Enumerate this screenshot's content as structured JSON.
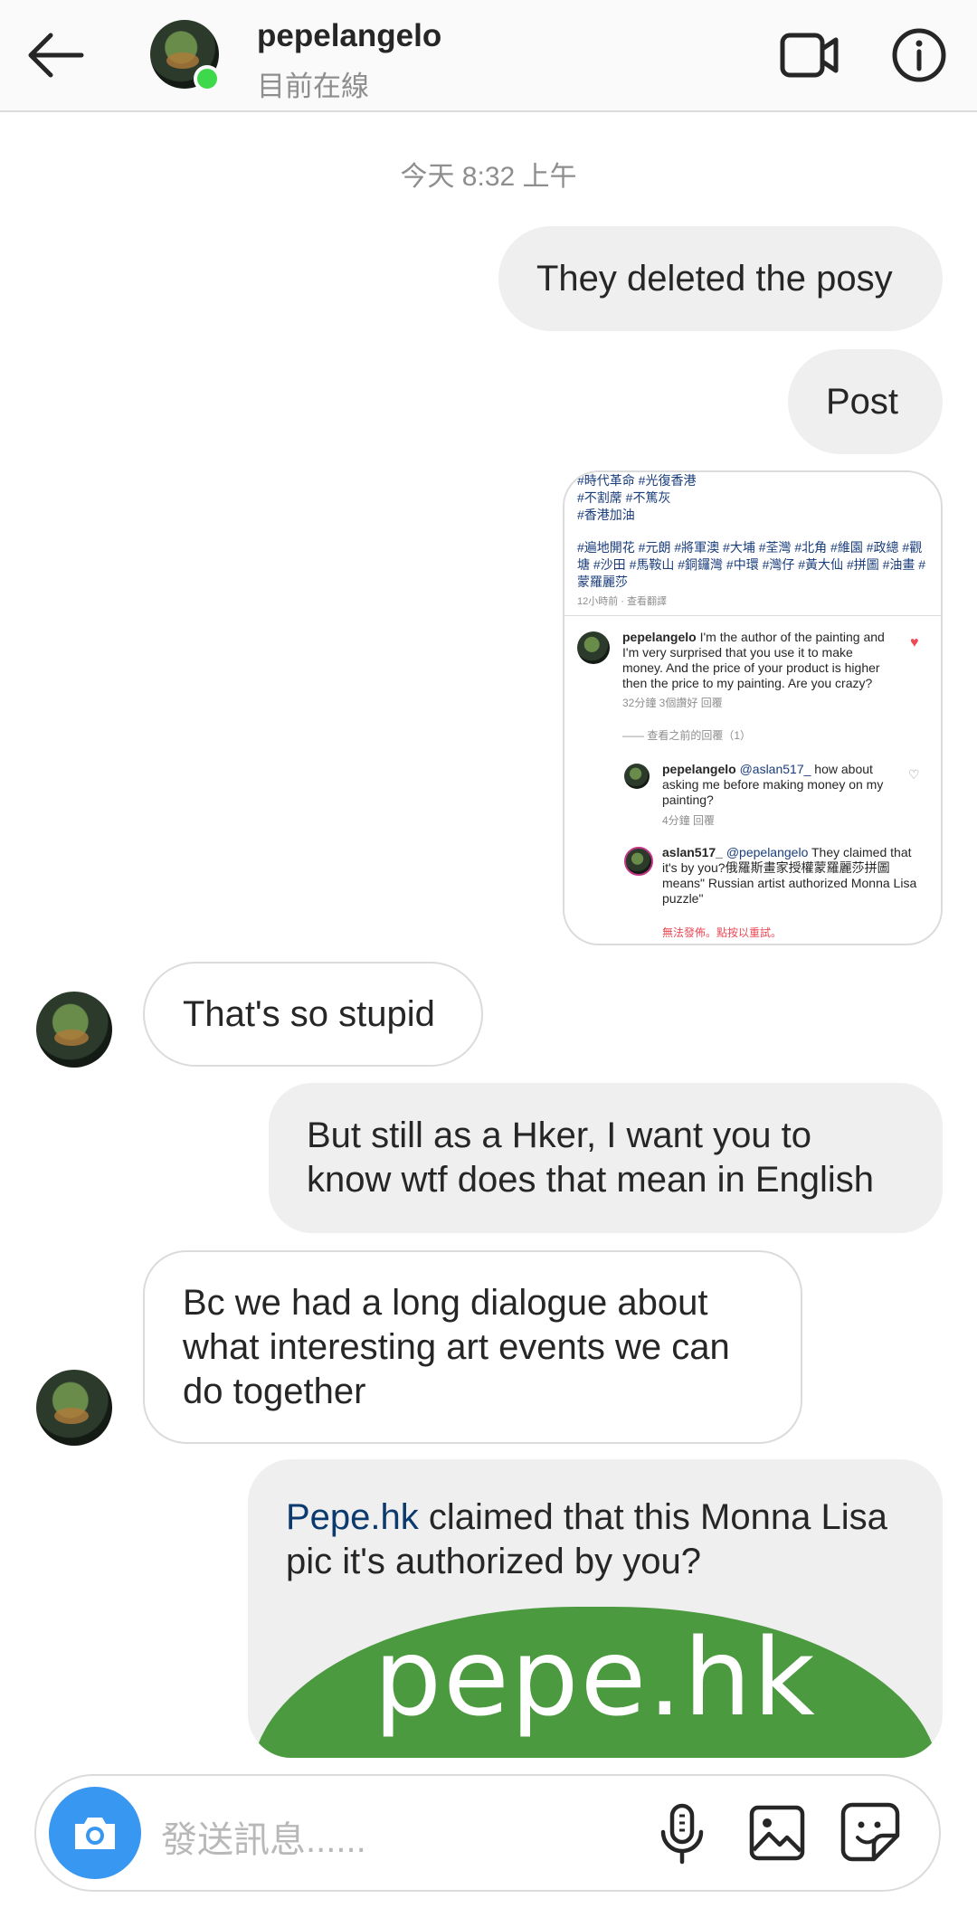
{
  "header": {
    "username": "pepelangelo",
    "status": "目前在線"
  },
  "chat": {
    "timestamp": "今天 8:32 上午",
    "messages": {
      "m1": "They deleted the posy",
      "m2": "Post",
      "m3": "That's so stupid",
      "m4": "But still as a Hker, I want you to know wtf does that mean in English",
      "m5": "Bc we had a long dialogue about what interesting art events we can do together",
      "m6_link": "Pepe.hk",
      "m6_rest": " claimed that this Monna Lisa pic it's authorized by you?",
      "m6_card_logo": "pepe.hk"
    },
    "shared_post": {
      "tags_line1": "#時代革命 #光復香港",
      "tags_line2": "#不割蓆 #不篤灰",
      "tags_line3": "#香港加油",
      "tags_line4": "#遍地開花 #元朗 #將軍澳 #大埔 #荃灣 #北角 #維園 #政總 #觀塘 #沙田 #馬鞍山 #銅鑼灣 #中環 #灣仔 #黃大仙 #拼圖 #油畫 #蒙羅麗莎",
      "meta": "12小時前 · 查看翻譯",
      "c1_user": "pepelangelo",
      "c1_text": " I'm the author of the painting and I'm very surprised that you use it to make money. And the price of your product is higher then the price to my painting. Are you crazy?",
      "c1_meta": "32分鐘    3個讚好    回覆",
      "view_prev": "—— 查看之前的回覆（1）",
      "c2_user": "pepelangelo",
      "c2_mention": " @aslan517_",
      "c2_text": " how about asking me before making money on my painting?",
      "c2_meta": "4分鐘    回覆",
      "c3_user": "aslan517_",
      "c3_mention": " @pepelangelo",
      "c3_text": " They claimed that it's by you?俄羅斯畫家授權蒙羅麗莎拼圖 means\" Russian artist authorized Monna Lisa puzzle\"",
      "c3_fail": "無法發佈。點按以重試。"
    }
  },
  "composer": {
    "placeholder": "發送訊息......"
  },
  "colors": {
    "accent": "#3897f0",
    "online": "#3dd94a",
    "bubble_out": "#efefef",
    "brand_green": "#4c9a3f"
  },
  "icons": [
    "back-arrow-icon",
    "video-call-icon",
    "info-icon",
    "camera-icon",
    "microphone-icon",
    "gallery-icon",
    "sticker-icon"
  ]
}
